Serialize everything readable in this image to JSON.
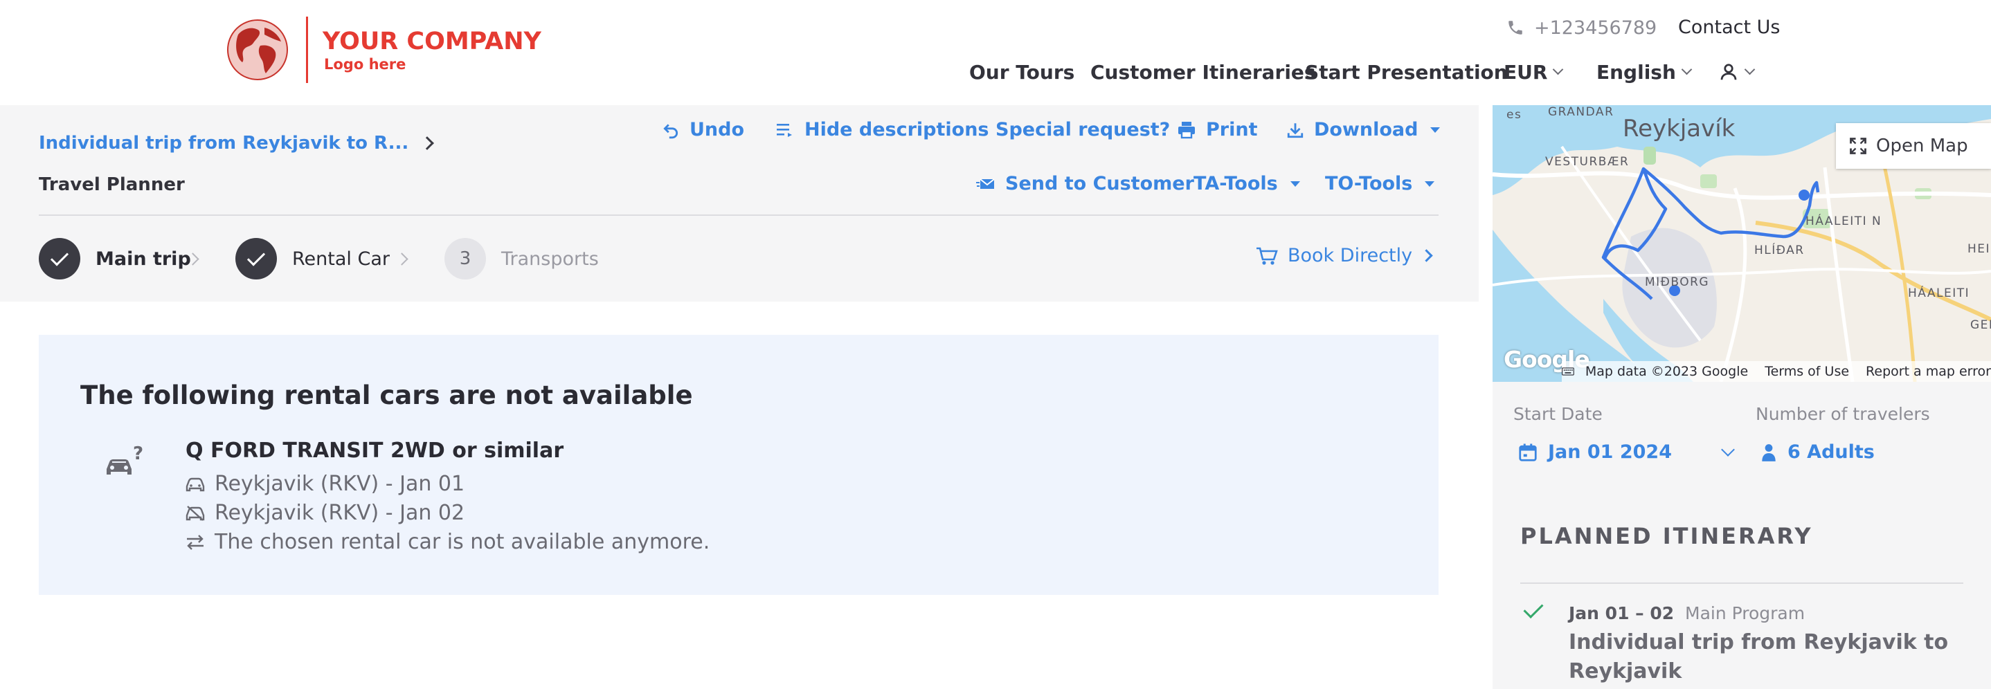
{
  "header": {
    "company": "YOUR COMPANY",
    "company_tagline": "Logo here",
    "phone": "+123456789",
    "contact": "Contact Us",
    "nav": {
      "tours": "Our Tours",
      "itineraries": "Customer Itineraries",
      "presentation": "Start Presentation",
      "currency": "EUR",
      "language": "English"
    }
  },
  "toolbar": {
    "trip_link": "Individual trip from Reykjavik to R...",
    "section_label": "Travel Planner",
    "undo": "Undo",
    "hide_descriptions": "Hide descriptions",
    "special_request": "Special request?",
    "print": "Print",
    "download": "Download",
    "send_to_customer": "Send to Customer",
    "ta_tools": "TA-Tools",
    "to_tools": "TO-Tools"
  },
  "steps": [
    {
      "label": "Main trip",
      "state": "done"
    },
    {
      "label": "Rental Car",
      "state": "done"
    },
    {
      "label": "Transports",
      "state": "pending",
      "number": "3"
    }
  ],
  "book_directly": "Book Directly",
  "notice": {
    "title": "The following rental cars are not available",
    "car_name": "Q FORD TRANSIT 2WD or similar",
    "pickup": "Reykjavik (RKV) - Jan 01",
    "dropoff": "Reykjavik (RKV) - Jan 02",
    "message": "The chosen rental car is not available anymore."
  },
  "map": {
    "open_map": "Open Map",
    "city": "Reykjavík",
    "districts": {
      "grandar": "GRANDAR",
      "vesturbaer": "VESTURBÆR",
      "haaleiti_n": "HÁALEITI N",
      "hlidar": "HLÍÐAR",
      "midborg": "MIÐBORG",
      "haaleiti": "HÁALEITI",
      "hei": "HEI",
      "ger": "GER",
      "es": "es"
    },
    "google": "Google",
    "map_data": "Map data ©2023 Google",
    "terms": "Terms of Use",
    "report": "Report a map error"
  },
  "side": {
    "start_date_label": "Start Date",
    "start_date": "Jan 01 2024",
    "travelers_label": "Number of travelers",
    "travelers": "6 Adults",
    "itinerary_title": "PLANNED ITINERARY",
    "item": {
      "dates": "Jan 01 – 02",
      "program": "Main Program",
      "title": "Individual trip from Reykjavik to Reykjavik"
    }
  },
  "colors": {
    "brand": "#e53b32",
    "accent": "#3a85e0",
    "success": "#34a86a"
  }
}
